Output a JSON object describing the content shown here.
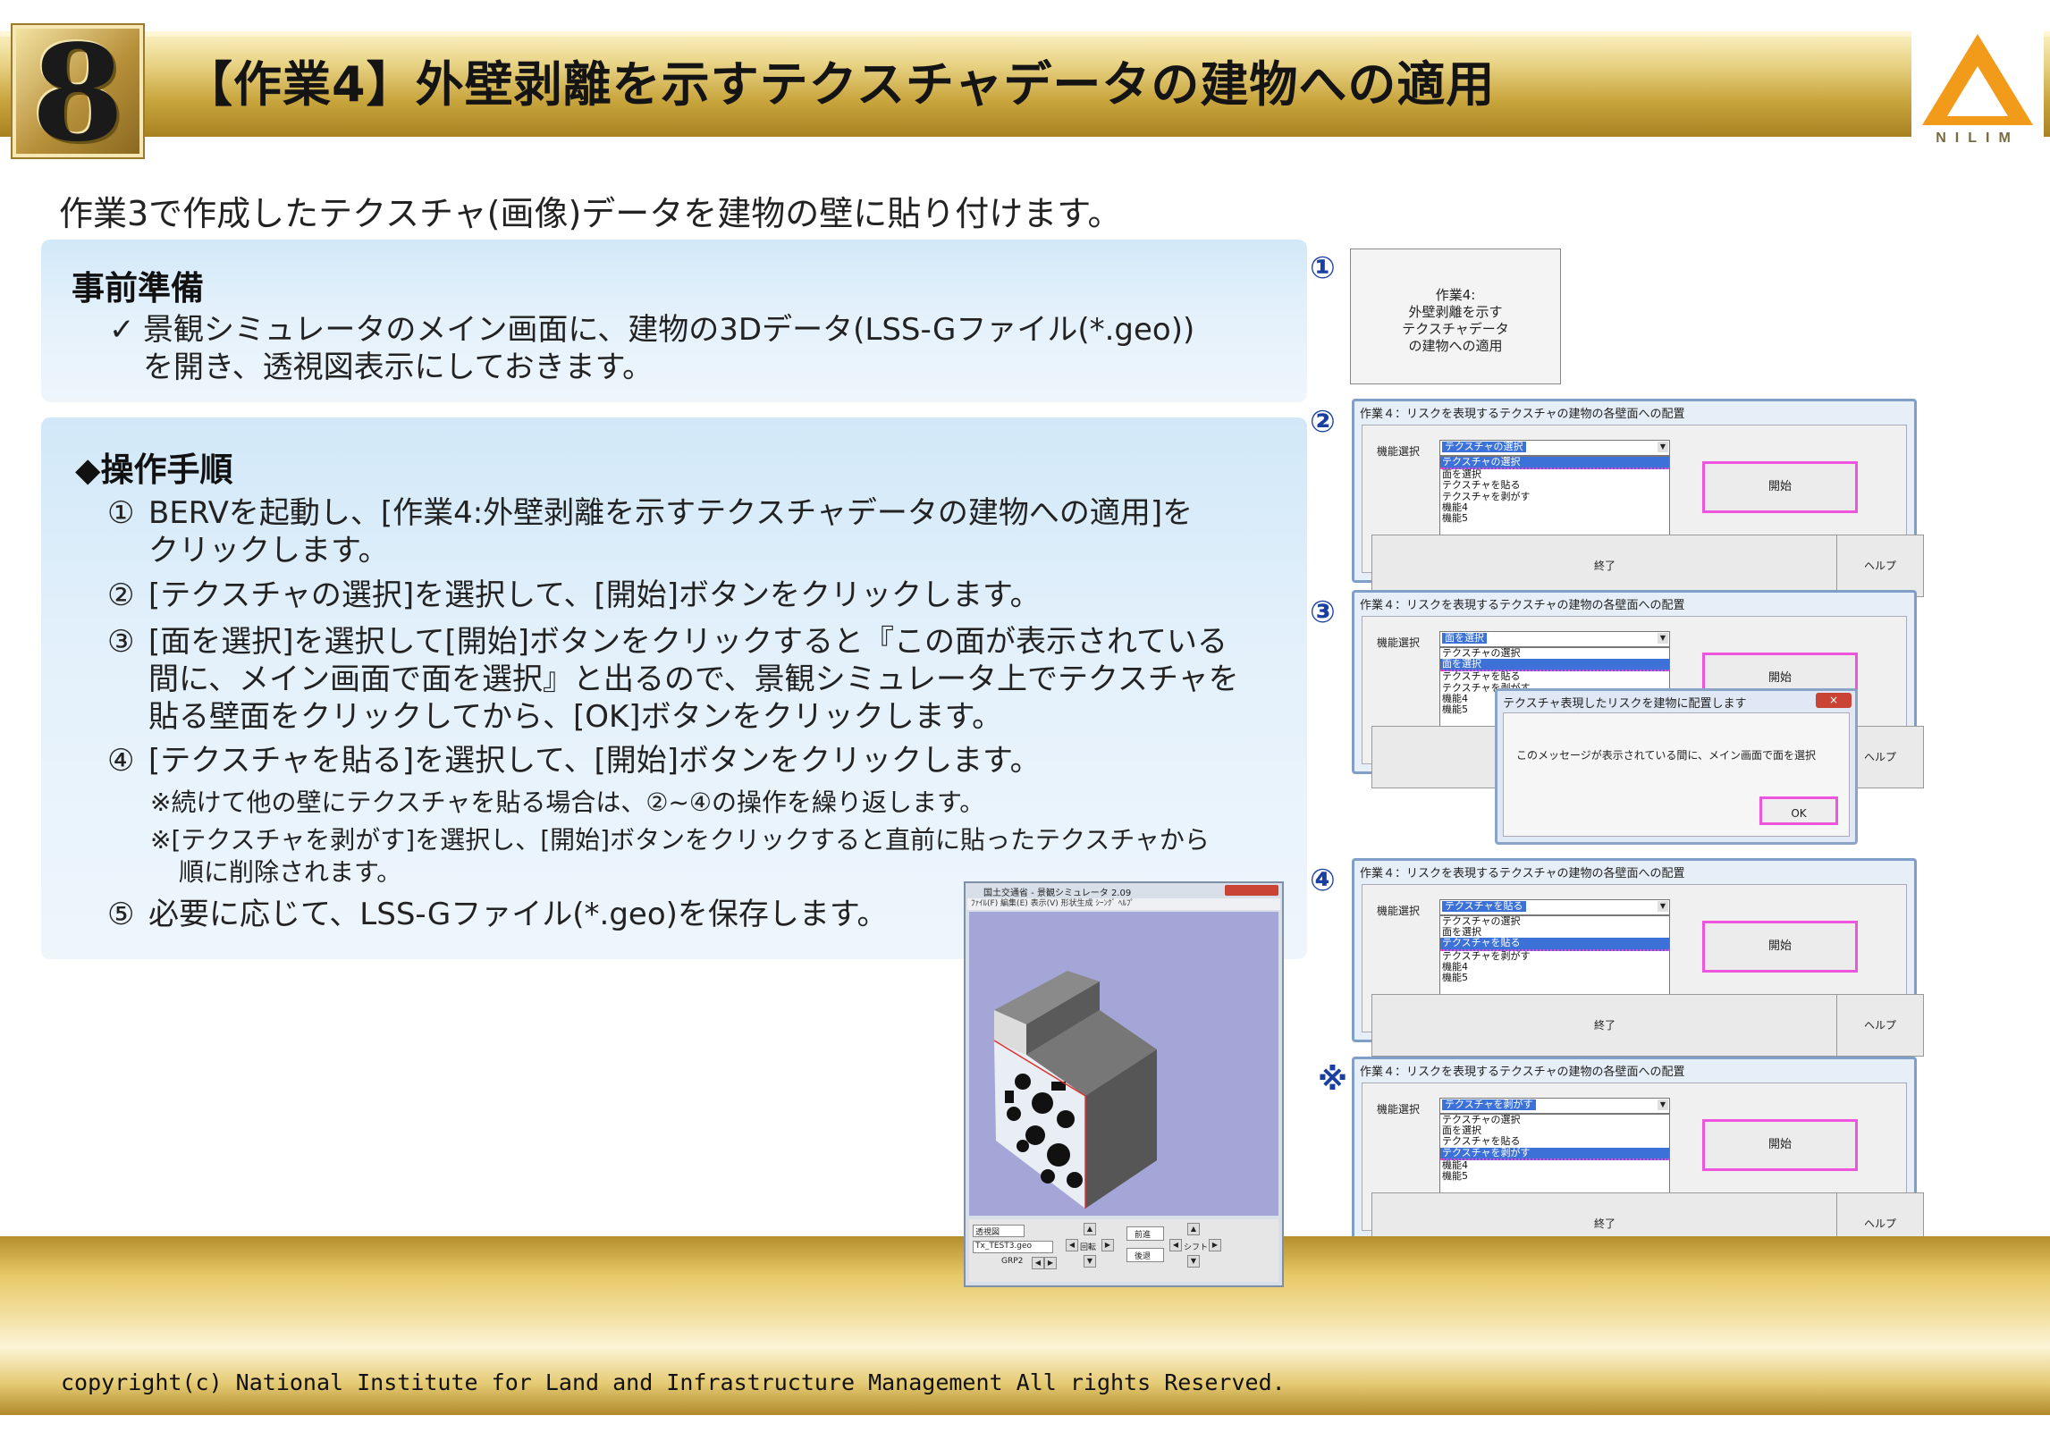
{
  "header": {
    "badge_number": "8",
    "title": "【作業4】外壁剥離を示すテクスチャデータの建物への適用",
    "logo_text": "NILIM"
  },
  "intro": "作業3で作成したテクスチャ(画像)データを建物の壁に貼り付けます。",
  "prep": {
    "heading": "事前準備",
    "check": "✓",
    "line1": "景観シミュレータのメイン画面に、建物の3Dデータ(LSS-Gファイル(*.geo))",
    "line2": "を開き、透視図表示にしておきます。"
  },
  "procedure": {
    "heading": "◆操作手順",
    "steps": [
      {
        "num": "①",
        "lines": [
          "BERVを起動し、[作業4:外壁剥離を示すテクスチャデータの建物への適用]を",
          "クリックします。"
        ]
      },
      {
        "num": "②",
        "lines": [
          "[テクスチャの選択]を選択して、[開始]ボタンをクリックします。"
        ]
      },
      {
        "num": "③",
        "lines": [
          "[面を選択]を選択して[開始]ボタンをクリックすると『この面が表示されている",
          "間に、メイン画面で面を選択』と出るので、景観シミュレータ上でテクスチャを",
          "貼る壁面をクリックしてから、[OK]ボタンをクリックします。"
        ]
      },
      {
        "num": "④",
        "lines": [
          "[テクスチャを貼る]を選択して、[開始]ボタンをクリックします。"
        ]
      },
      {
        "num": "⑤",
        "lines": [
          "必要に応じて、LSS-Gファイル(*.geo)を保存します。"
        ]
      }
    ],
    "notes": [
      "※続けて他の壁にテクスチャを貼る場合は、②~④の操作を繰り返します。",
      "※[テクスチャを剥がす]を選択し、[開始]ボタンをクリックすると直前に貼ったテクスチャから",
      "順に削除されます。"
    ]
  },
  "screens": {
    "markers": [
      "①",
      "②",
      "③",
      "④",
      "※"
    ],
    "box1_lines": [
      "作業4:",
      "外壁剥離を示す",
      "テクスチャデータ",
      "の建物への適用"
    ],
    "dialog_title": "作業４：リスクを表現するテクスチャの建物の各壁面への配置",
    "func_label": "機能選択",
    "options": [
      "テクスチャの選択",
      "面を選択",
      "テクスチャを貼る",
      "テクスチャを剥がす",
      "機能4",
      "機能5"
    ],
    "start_label": "開始",
    "end_label": "終了",
    "help_label": "ヘルプ",
    "dialogs": [
      {
        "combo_value": "テクスチャの選択",
        "selected_index": 0
      },
      {
        "combo_value": "面を選択",
        "selected_index": 1
      },
      {
        "combo_value": "テクスチャを貼る",
        "selected_index": 2
      },
      {
        "combo_value": "テクスチャを剥がす",
        "selected_index": 3
      }
    ],
    "msgbox": {
      "title": "テクスチャ表現したリスクを建物に配置します",
      "close": "×",
      "text": "このメッセージが表示されている間に、メイン画面で面を選択",
      "ok": "OK"
    },
    "sim_window": {
      "title": "国土交通省 - 景観シミュレータ 2.09",
      "menu": "ﾌｧｲﾙ(F)  編集(E)  表示(V)  形状生成  ｼｰﾝｸﾞ  ﾍﾙﾌﾟ",
      "view_mode": "透視図",
      "file": "Tx_TEST3.geo",
      "group": "GRP2",
      "forward": "前進",
      "back": "後退",
      "rotate": "回転",
      "shift": "シフト"
    }
  },
  "footer": {
    "copyright": "copyright(c) National Institute for Land and Infrastructure Management All rights Reserved."
  },
  "colors": {
    "gold": "#c9a63e",
    "panel_blue": "#d2e8f8",
    "highlight_pink": "#ee55dd",
    "select_blue": "#3c72d8"
  }
}
